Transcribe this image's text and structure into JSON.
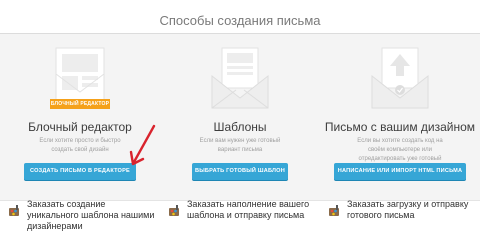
{
  "title": "Способы создания письма",
  "columns": [
    {
      "heading": "Блочный редактор",
      "description": "Если хотите просто и быстро создать свой дизайн",
      "badge": "БЛОЧНЫЙ РЕДАКТОР",
      "button": "СОЗДАТЬ ПИСЬМО В РЕДАКТОРЕ",
      "order_link": "Заказать создание уникального шаблона нашими дизайнерами"
    },
    {
      "heading": "Шаблоны",
      "description": "Если вам нужен уже готовый вариант письма",
      "button": "ВЫБРАТЬ ГОТОВЫЙ ШАБЛОН",
      "order_link": "Заказать наполнение вашего шаблона и отправку письма"
    },
    {
      "heading": "Письмо с вашим дизайном",
      "description": "Если вы хотите создать код на своём компьютере или отредактировать уже готовый",
      "button": "НАПИСАНИЕ ИЛИ ИМПОРТ HTML ПИСЬМА",
      "order_link": "Заказать загрузку и отправку готового письма"
    }
  ],
  "colors": {
    "button": "#36a6d6",
    "badge": "#f5a11a",
    "arrow": "#d9232d",
    "panel": "#f4f4f4"
  }
}
